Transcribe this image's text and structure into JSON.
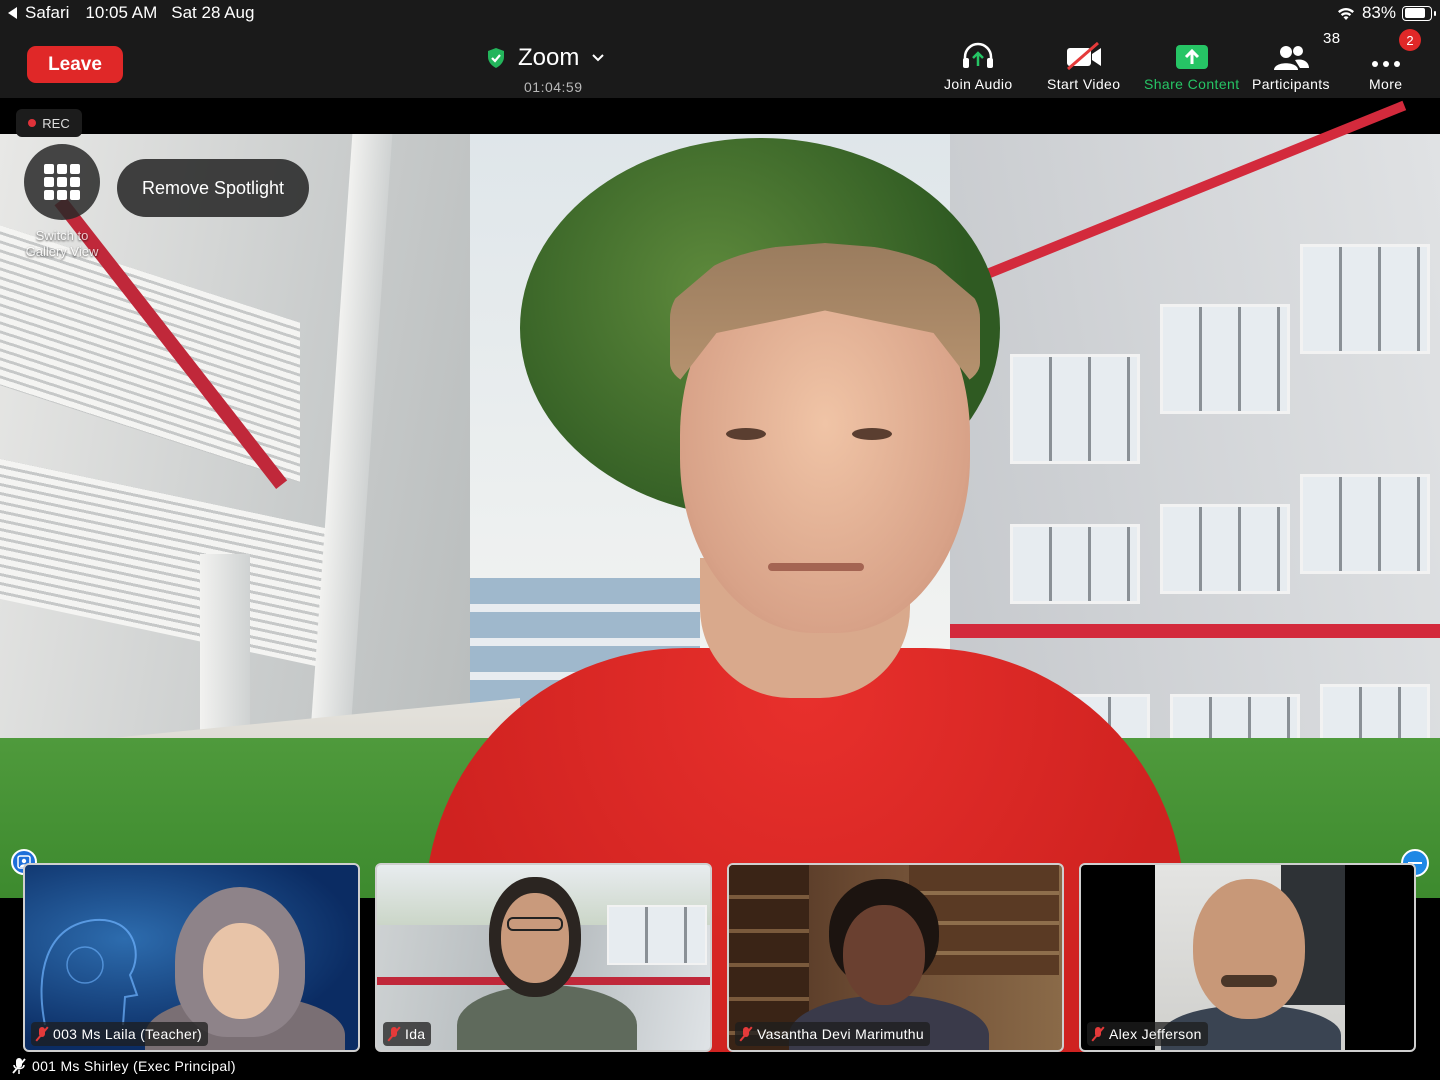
{
  "status_bar": {
    "back_app": "Safari",
    "time": "10:05 AM",
    "date": "Sat 28 Aug",
    "battery": "83%",
    "battery_level": 0.83
  },
  "toolbar": {
    "leave_label": "Leave",
    "meeting_title": "Zoom",
    "elapsed": "01:04:59",
    "join_audio_label": "Join Audio",
    "start_video_label": "Start Video",
    "share_content_label": "Share Content",
    "participants_label": "Participants",
    "participants_count": "38",
    "more_label": "More",
    "more_badge": "2",
    "share_color": "#26c565",
    "leave_color": "#e02828"
  },
  "stage": {
    "rec_label": "REC",
    "gallery_label": "Switch to Gallery View",
    "spotlight_label": "Remove Spotlight"
  },
  "thumbnails": [
    {
      "name": "003 Ms Laila (Teacher)"
    },
    {
      "name": "Ida"
    },
    {
      "name": "Vasantha Devi Marimuthu"
    },
    {
      "name": "Alex Jefferson"
    }
  ],
  "active_speaker": {
    "name": "001 Ms Shirley (Exec Principal)"
  }
}
